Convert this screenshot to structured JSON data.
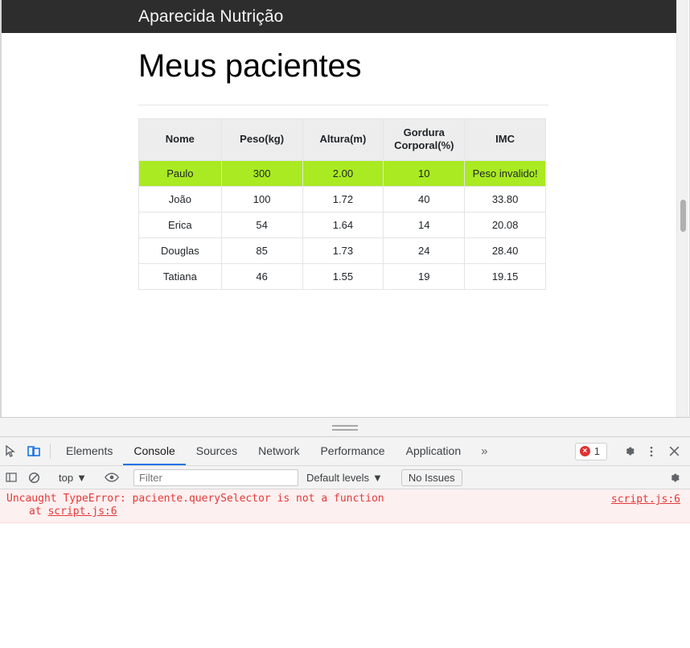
{
  "page": {
    "navbar": {
      "brand": "Aparecida Nutrição"
    },
    "heading": "Meus pacientes",
    "table": {
      "columns": [
        "Nome",
        "Peso(kg)",
        "Altura(m)",
        "Gordura Corporal(%)",
        "IMC"
      ],
      "columns_display": {
        "nome": "Nome",
        "peso": "Peso(kg)",
        "altura": "Altura(m)",
        "gordura_line1": "Gordura",
        "gordura_line2": "Corporal(%)",
        "imc": "IMC"
      },
      "rows": [
        {
          "nome": "Paulo",
          "peso": "300",
          "altura": "2.00",
          "gordura": "10",
          "imc": "Peso invalido!",
          "invalid": true
        },
        {
          "nome": "João",
          "peso": "100",
          "altura": "1.72",
          "gordura": "40",
          "imc": "33.80",
          "invalid": false
        },
        {
          "nome": "Erica",
          "peso": "54",
          "altura": "1.64",
          "gordura": "14",
          "imc": "20.08",
          "invalid": false
        },
        {
          "nome": "Douglas",
          "peso": "85",
          "altura": "1.73",
          "gordura": "24",
          "imc": "28.40",
          "invalid": false
        },
        {
          "nome": "Tatiana",
          "peso": "46",
          "altura": "1.55",
          "gordura": "19",
          "imc": "19.15",
          "invalid": false
        }
      ]
    },
    "colors": {
      "navbar_background": "#2d2d2d",
      "invalid_row_highlight": "#a9ea22",
      "table_header_background": "#ededed"
    }
  },
  "devtools": {
    "tabs": [
      {
        "label": "Elements",
        "active": false
      },
      {
        "label": "Console",
        "active": true
      },
      {
        "label": "Sources",
        "active": false
      },
      {
        "label": "Network",
        "active": false
      },
      {
        "label": "Performance",
        "active": false
      },
      {
        "label": "Application",
        "active": false
      }
    ],
    "more_tabs_icon": "»",
    "error_count": "1",
    "toolbar_icons": {
      "inspect": "inspect-element-icon",
      "device": "device-toolbar-icon",
      "settings": "gear-icon",
      "kebab": "more-options-icon",
      "close": "close-icon"
    },
    "console_toolbar": {
      "clear_icon": "clear-console-icon",
      "sidebar_icon": "console-sidebar-icon",
      "context": "top",
      "context_caret": "▼",
      "eye_icon": "live-expression-icon",
      "filter_value": "",
      "filter_placeholder": "Filter",
      "levels": "Default levels",
      "levels_caret": "▼",
      "issues": "No Issues",
      "settings_icon": "gear-icon"
    },
    "console_messages": [
      {
        "text": "Uncaught TypeError: paciente.querySelector is not a function",
        "stack_prefix": "at ",
        "stack_link": "script.js:6",
        "source": "script.js:6",
        "level": "error"
      }
    ]
  }
}
